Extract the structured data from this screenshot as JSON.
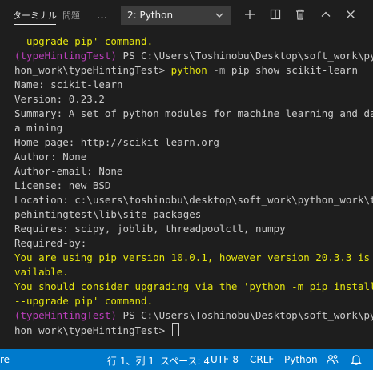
{
  "panel": {
    "tabs": [
      {
        "label": "ターミナル",
        "active": true
      },
      {
        "label": "問題",
        "active": false
      }
    ],
    "more_label": "…",
    "terminal_select": {
      "value": "2: Python"
    },
    "actions": [
      "plus-icon",
      "split-icon",
      "trash-icon",
      "chevron-up-icon",
      "close-icon"
    ]
  },
  "terminal": {
    "lines": [
      {
        "segments": [
          {
            "text": "--upgrade pip' command.",
            "color": "yellow"
          }
        ]
      },
      {
        "segments": [
          {
            "text": "(typeHintingTest)",
            "color": "magenta"
          },
          {
            "text": " PS C:\\Users\\Toshinobu\\Desktop\\soft_work\\pyt",
            "color": "default"
          }
        ]
      },
      {
        "segments": [
          {
            "text": "hon_work\\typeHintingTest> ",
            "color": "default"
          },
          {
            "text": "python",
            "color": "yellow"
          },
          {
            "text": " -m",
            "color": "dim"
          },
          {
            "text": " pip show scikit-learn",
            "color": "default"
          }
        ]
      },
      {
        "segments": [
          {
            "text": "Name: scikit-learn",
            "color": "default"
          }
        ]
      },
      {
        "segments": [
          {
            "text": "Version: 0.23.2",
            "color": "default"
          }
        ]
      },
      {
        "segments": [
          {
            "text": "Summary: A set of python modules for machine learning and dat",
            "color": "default"
          }
        ]
      },
      {
        "segments": [
          {
            "text": "a mining",
            "color": "default"
          }
        ]
      },
      {
        "segments": [
          {
            "text": "Home-page: http://scikit-learn.org",
            "color": "default"
          }
        ]
      },
      {
        "segments": [
          {
            "text": "Author: None",
            "color": "default"
          }
        ]
      },
      {
        "segments": [
          {
            "text": "Author-email: None",
            "color": "default"
          }
        ]
      },
      {
        "segments": [
          {
            "text": "License: new BSD",
            "color": "default"
          }
        ]
      },
      {
        "segments": [
          {
            "text": "Location: c:\\users\\toshinobu\\desktop\\soft_work\\python_work\\ty",
            "color": "default"
          }
        ]
      },
      {
        "segments": [
          {
            "text": "pehintingtest\\lib\\site-packages",
            "color": "default"
          }
        ]
      },
      {
        "segments": [
          {
            "text": "Requires: scipy, joblib, threadpoolctl, numpy",
            "color": "default"
          }
        ]
      },
      {
        "segments": [
          {
            "text": "Required-by:",
            "color": "default"
          }
        ]
      },
      {
        "segments": [
          {
            "text": "You are using pip version 10.0.1, however version 20.3.3 is a",
            "color": "yellow"
          }
        ]
      },
      {
        "segments": [
          {
            "text": "vailable.",
            "color": "yellow"
          }
        ]
      },
      {
        "segments": [
          {
            "text": "You should consider upgrading via the 'python -m pip install",
            "color": "yellow"
          }
        ]
      },
      {
        "segments": [
          {
            "text": "--upgrade pip' command.",
            "color": "yellow"
          }
        ]
      },
      {
        "segments": [
          {
            "text": "(typeHintingTest)",
            "color": "magenta"
          },
          {
            "text": " PS C:\\Users\\Toshinobu\\Desktop\\soft_work\\pyt",
            "color": "default"
          }
        ]
      },
      {
        "segments": [
          {
            "text": "hon_work\\typeHintingTest> ",
            "color": "default"
          }
        ],
        "cursor": true
      }
    ]
  },
  "statusbar": {
    "left_fragment": "re",
    "position": "行 1、列 1",
    "spaces": "スペース: 4",
    "encoding": "UTF-8",
    "eol": "CRLF",
    "language": "Python",
    "icons": [
      "feedback-icon",
      "bell-icon"
    ],
    "colors": {
      "background": "#007acc"
    }
  },
  "colors": {
    "terminal_bg": "#1e1e1e",
    "text": "#cccccc",
    "yellow": "#e5e510",
    "magenta": "#bc3fbc"
  }
}
